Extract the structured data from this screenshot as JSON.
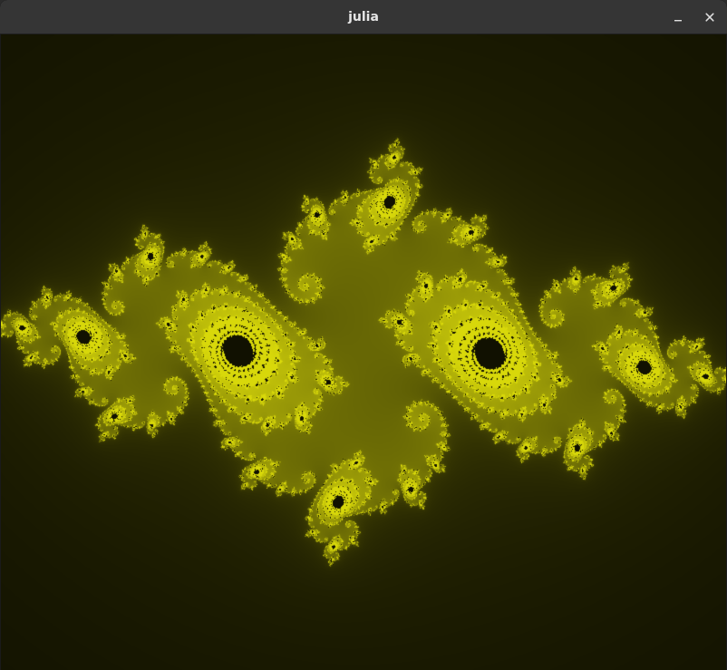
{
  "window": {
    "title": "julia",
    "minimize_icon": "minimize-icon",
    "close_icon": "close-icon"
  },
  "render": {
    "fractal": "julia-set",
    "colors": {
      "background": "#000000",
      "fractal": "#d8d800",
      "titlebar": "#353535",
      "title_text": "#e6e6e6"
    }
  }
}
